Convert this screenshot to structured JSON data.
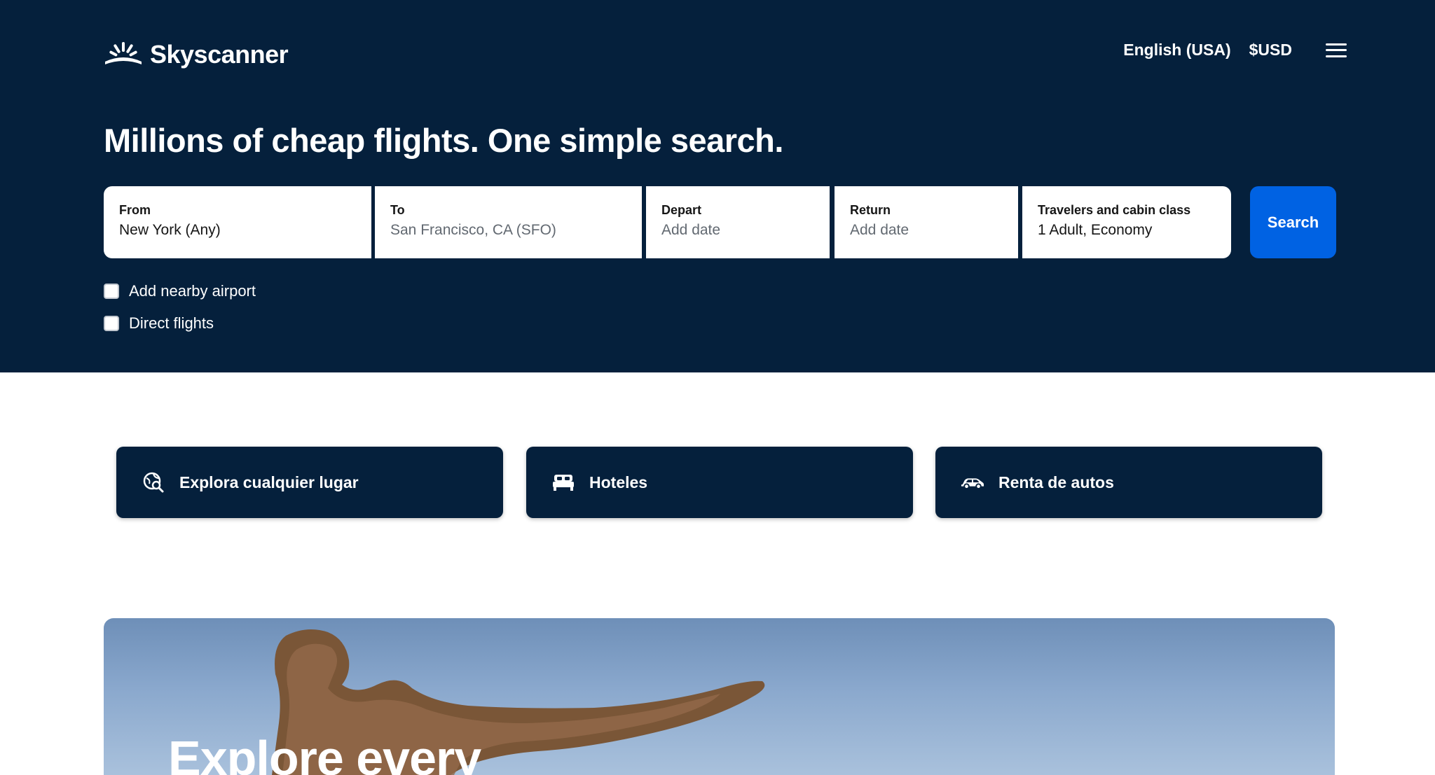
{
  "brand": {
    "name": "Skyscanner",
    "logo_icon": "sunrise-icon"
  },
  "nav": {
    "language": "English (USA)",
    "currency": "$USD",
    "menu_icon": "hamburger-menu-icon"
  },
  "hero": {
    "headline": "Millions of cheap flights. One simple search."
  },
  "search": {
    "from": {
      "label": "From",
      "value": "New York (Any)"
    },
    "to": {
      "label": "To",
      "placeholder": "San Francisco, CA (SFO)"
    },
    "depart": {
      "label": "Depart",
      "placeholder": "Add date"
    },
    "return": {
      "label": "Return",
      "placeholder": "Add date"
    },
    "travelers": {
      "label": "Travelers and cabin class",
      "value": "1 Adult, Economy"
    },
    "button_label": "Search"
  },
  "options": {
    "nearby_airport": {
      "label": "Add nearby airport",
      "checked": false
    },
    "direct_flights": {
      "label": "Direct flights",
      "checked": false
    }
  },
  "quick_links": [
    {
      "label": "Explora cualquier lugar",
      "icon": "globe-search-icon"
    },
    {
      "label": "Hoteles",
      "icon": "bed-icon"
    },
    {
      "label": "Renta de autos",
      "icon": "car-icon"
    }
  ],
  "banner": {
    "title": "Explore every"
  },
  "colors": {
    "hero_bg": "#05203c",
    "accent": "#0062e3",
    "text_dark": "#161616"
  }
}
